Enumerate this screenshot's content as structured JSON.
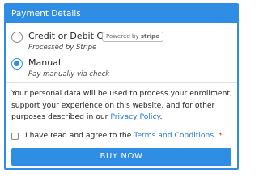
{
  "panel": {
    "title": "Payment Details"
  },
  "payment_options": [
    {
      "label": "Credit or Debit Card",
      "subtitle": "Processed by Stripe",
      "selected": false,
      "badge_prefix": "Powered by",
      "badge_brand": "stripe"
    },
    {
      "label": "Manual",
      "subtitle": "Pay manually via check",
      "selected": true
    }
  ],
  "privacy_notice": {
    "text": "Your personal data will be used to process your enrollment, support your experience on this website, and for other purposes described in our ",
    "link_text": "Privacy Policy",
    "suffix": "."
  },
  "terms": {
    "prefix": "I have read and agree to the ",
    "link_text": "Terms and Conditions",
    "suffix": ". ",
    "required_mark": "*",
    "checked": false
  },
  "buy_button": {
    "label": "BUY NOW"
  },
  "colors": {
    "accent": "#2f8de4",
    "link": "#1f79d1",
    "required": "#d9331d"
  }
}
